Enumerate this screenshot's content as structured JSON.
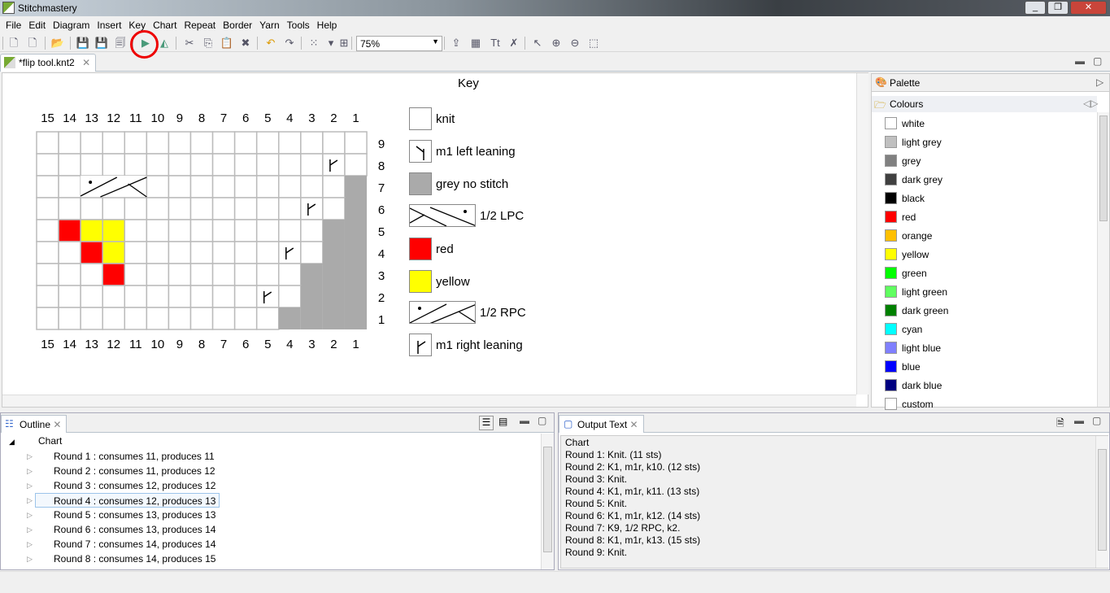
{
  "window": {
    "title": "Stitchmastery",
    "buttons": [
      "minimize",
      "restore",
      "close"
    ]
  },
  "menu": [
    "File",
    "Edit",
    "Diagram",
    "Insert",
    "Key",
    "Chart",
    "Repeat",
    "Border",
    "Yarn",
    "Tools",
    "Help"
  ],
  "toolbar": {
    "zoom": "75%",
    "icons": [
      "new-chart-icon",
      "new-key-icon",
      "open-icon",
      "save-icon",
      "save-as-icon",
      "save-all-icon",
      "flip-tool-icon",
      "mirror-icon",
      "cut-icon",
      "copy-icon",
      "paste-icon",
      "delete-icon",
      "undo-icon",
      "redo-icon",
      "select-grid-icon",
      "dropdown-icon",
      "layout-icon",
      "import-icon",
      "image-icon",
      "text-icon",
      "remove-icon",
      "pointer-icon",
      "zoom-in-icon",
      "zoom-out-icon",
      "marquee-icon"
    ],
    "highlight": "flip-tool-icon"
  },
  "editor": {
    "tab": "*flip tool.knt2",
    "key_title": "Key"
  },
  "chart_data": {
    "type": "table",
    "columns": [
      "15",
      "14",
      "13",
      "12",
      "11",
      "10",
      "9",
      "8",
      "7",
      "6",
      "5",
      "4",
      "3",
      "2",
      "1"
    ],
    "row_labels": [
      "9",
      "8",
      "7",
      "6",
      "5",
      "4",
      "3",
      "2",
      "1"
    ],
    "cells": [
      "...............",
      ".............m.",
      "..C--.........g",
      "............m.g",
      ".ryy.........gg",
      "..ry.......m.gg",
      "...r........ggg",
      "..........m.ggg",
      "...........gggg"
    ],
    "legend_codes": {
      ".": "knit",
      "g": "grey no stitch",
      "r": "red",
      "y": "yellow",
      "m": "m1 right leaning",
      "C": "1/2 RPC"
    },
    "colors": {
      "grey": "#aaaaaa",
      "red": "#ff0000",
      "yellow": "#ffff00"
    }
  },
  "key": [
    {
      "label": "knit",
      "symbol": "knit"
    },
    {
      "label": "m1 left leaning",
      "symbol": "m1l"
    },
    {
      "label": "grey no stitch",
      "symbol": "grey"
    },
    {
      "label": "1/2 LPC",
      "symbol": "lpc"
    },
    {
      "label": "red",
      "symbol": "red"
    },
    {
      "label": "yellow",
      "symbol": "yellow"
    },
    {
      "label": "1/2 RPC",
      "symbol": "rpc"
    },
    {
      "label": "m1 right leaning",
      "symbol": "m1r"
    }
  ],
  "palette": {
    "title": "Palette",
    "section": "Colours",
    "colours": [
      {
        "name": "white",
        "hex": "#ffffff"
      },
      {
        "name": "light grey",
        "hex": "#c0c0c0"
      },
      {
        "name": "grey",
        "hex": "#808080"
      },
      {
        "name": "dark grey",
        "hex": "#404040"
      },
      {
        "name": "black",
        "hex": "#000000"
      },
      {
        "name": "red",
        "hex": "#ff0000"
      },
      {
        "name": "orange",
        "hex": "#ffc000"
      },
      {
        "name": "yellow",
        "hex": "#ffff00"
      },
      {
        "name": "green",
        "hex": "#00ff00"
      },
      {
        "name": "light green",
        "hex": "#60ff60"
      },
      {
        "name": "dark green",
        "hex": "#008000"
      },
      {
        "name": "cyan",
        "hex": "#00ffff"
      },
      {
        "name": "light blue",
        "hex": "#8080ff"
      },
      {
        "name": "blue",
        "hex": "#0000ff"
      },
      {
        "name": "dark blue",
        "hex": "#000080"
      },
      {
        "name": "custom",
        "hex": "#ffffff"
      }
    ]
  },
  "outline": {
    "title": "Outline",
    "root": "Chart",
    "rounds": [
      "Round 1 : consumes 11, produces 11",
      "Round 2 : consumes 11, produces 12",
      "Round 3 : consumes 12, produces 12",
      "Round 4 : consumes 12, produces 13",
      "Round 5 : consumes 13, produces 13",
      "Round 6 : consumes 13, produces 14",
      "Round 7 : consumes 14, produces 14",
      "Round 8 : consumes 14, produces 15"
    ],
    "selected": 3
  },
  "output": {
    "title": "Output Text",
    "lines": [
      "Chart",
      "Round 1: Knit. (11 sts)",
      "Round 2: K1, m1r, k10. (12 sts)",
      "Round 3: Knit.",
      "Round 4: K1, m1r, k11. (13 sts)",
      "Round 5: Knit.",
      "Round 6: K1, m1r, k12. (14 sts)",
      "Round 7: K9, 1/2 RPC, k2.",
      "Round 8: K1, m1r, k13. (15 sts)",
      "Round 9: Knit."
    ]
  }
}
